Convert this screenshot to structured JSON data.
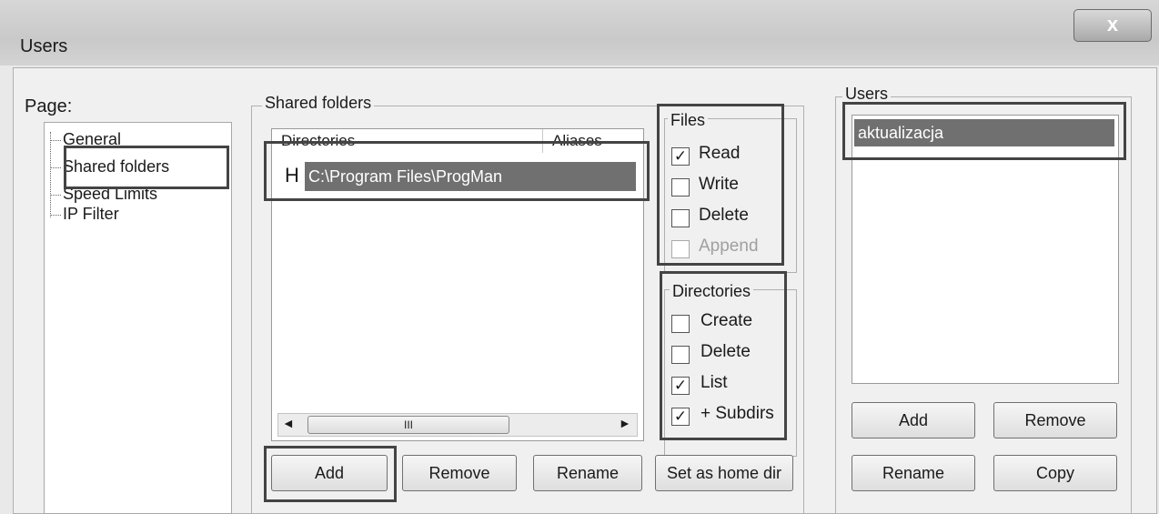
{
  "window": {
    "title": "Users",
    "close_glyph": "x"
  },
  "page": {
    "label": "Page:",
    "items": [
      {
        "label": "General"
      },
      {
        "label": "Shared folders"
      },
      {
        "label": "Speed Limits"
      },
      {
        "label": "IP Filter"
      }
    ]
  },
  "shared": {
    "group_title": "Shared folders",
    "columns": [
      "Directories",
      "Aliases"
    ],
    "rows": [
      {
        "flag": "H",
        "path": "C:\\Program Files\\ProgMan"
      }
    ],
    "scroll_left": "◄",
    "scroll_right": "►",
    "scroll_thumb": "III",
    "buttons": {
      "add": "Add",
      "remove": "Remove",
      "rename": "Rename",
      "set_home": "Set as home dir"
    }
  },
  "files": {
    "title": "Files",
    "items": [
      {
        "label": "Read",
        "checked": true
      },
      {
        "label": "Write",
        "checked": false
      },
      {
        "label": "Delete",
        "checked": false
      },
      {
        "label": "Append",
        "checked": false,
        "disabled": true
      }
    ]
  },
  "directories": {
    "title": "Directories",
    "items": [
      {
        "label": "Create",
        "checked": false
      },
      {
        "label": "Delete",
        "checked": false
      },
      {
        "label": "List",
        "checked": true
      },
      {
        "label": "+ Subdirs",
        "checked": true
      }
    ]
  },
  "users": {
    "title": "Users",
    "list": [
      "aktualizacja"
    ],
    "buttons": {
      "add": "Add",
      "remove": "Remove",
      "rename": "Rename",
      "copy": "Copy"
    }
  },
  "check_glyph": "✓",
  "colors": {
    "selection": "#707070",
    "highlight_frame": "#444444"
  }
}
